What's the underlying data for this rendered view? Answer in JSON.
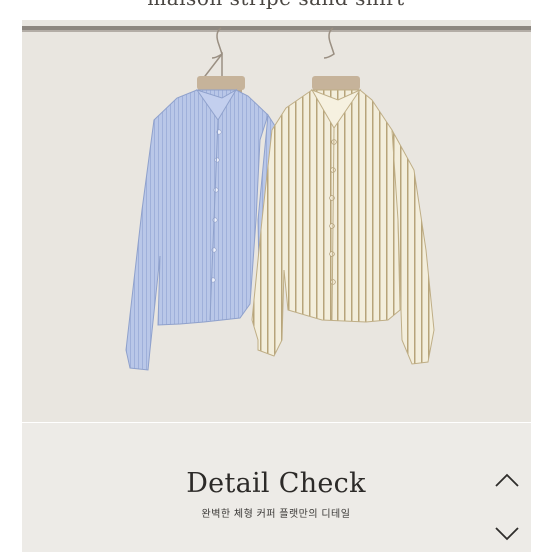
{
  "header": {
    "title": "maison stripe sand shirt"
  },
  "detail": {
    "title": "Detail Check",
    "subtitle": "완벽한 체형 커퍼 플랫만의 디테일"
  },
  "nav": {
    "up_icon": "chevron-up-icon",
    "down_icon": "chevron-down-icon"
  },
  "colors": {
    "background": "#e9e6e0",
    "panel": "#edebe7",
    "blue_shirt": "#b8c6e6",
    "cream_shirt": "#f2ecd8",
    "stripe": "#b3a27a"
  }
}
